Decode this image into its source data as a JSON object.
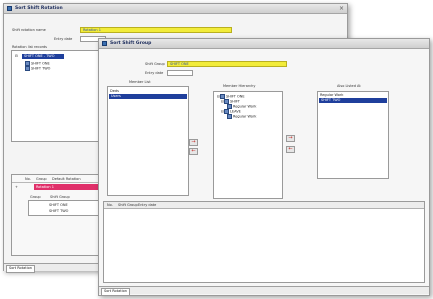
{
  "back_window": {
    "title": "Sort Shift Rotation",
    "rotation_label": "Shift rotation name",
    "rotation_value": "Rotation 1",
    "entry_label": "Entry date",
    "rotation_list_label": "Rotation list records",
    "tree_items": [
      "SHIFT ONE - TWO",
      "SHIFT ONE",
      "SHIFT TWO"
    ],
    "grid_headers": [
      "No.",
      "Group",
      "Default Rotation"
    ],
    "pink_row": "Rotation 1",
    "sub_headers": [
      "Group",
      "Shift Group"
    ],
    "sub_rows": [
      "SHIFT ONE",
      "SHIFT TWO"
    ],
    "tab_label": "Sort Rotation"
  },
  "front_window": {
    "title": "Sort Shift Group",
    "shift_group_label": "Shift Group",
    "shift_group_value": "SHIFT ONE",
    "entry_label": "Entry date",
    "member_list_label": "Member List",
    "member_items": [
      "Deds",
      "Users"
    ],
    "member_hierarchy_label": "Member Hierarchy",
    "hierarchy_items": [
      "SHIFT ONE",
      "SHIFT",
      "Regular Work",
      "LEAVE",
      "Regular Work"
    ],
    "also_listed_label": "Also Listed At",
    "also_listed_items": [
      "Regular Work",
      "SHIFT TWO"
    ],
    "grid_headers": [
      "No.",
      "Shift Group",
      "Entry date"
    ],
    "tab_label": "Sort Rotation",
    "arrow_right": "→",
    "arrow_left": "←"
  }
}
